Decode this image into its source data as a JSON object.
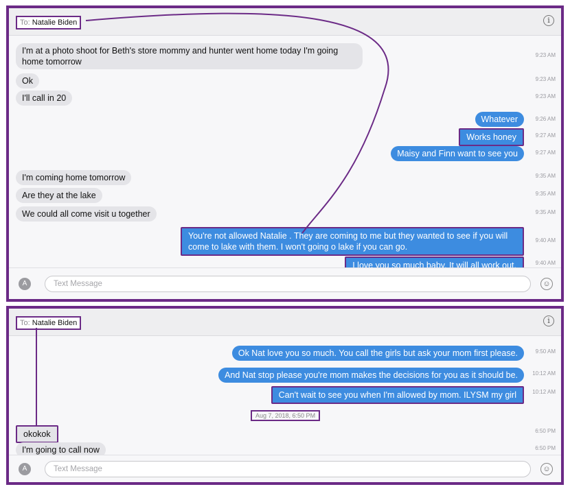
{
  "recipient": {
    "prefix": "To:",
    "name": "Natalie Biden"
  },
  "panel1": {
    "messages": [
      {
        "text": "I'm at a photo shoot for Beth's store mommy and hunter went home today I'm going",
        "text2": "home tomorrow",
        "time": "9:23 AM"
      },
      {
        "text": "Ok",
        "time": "9:23 AM"
      },
      {
        "text": "I'll call in 20",
        "time": "9:23 AM"
      },
      {
        "text": "Whatever",
        "time": "9:26 AM"
      },
      {
        "text": "Works honey",
        "time": "9:27 AM"
      },
      {
        "text": "Maisy and Finn want to see you",
        "time": "9:27 AM"
      },
      {
        "text": "I'm coming home tomorrow",
        "time": "9:35 AM"
      },
      {
        "text": "Are they at the lake",
        "time": "9:35 AM"
      },
      {
        "text": "We could all come visit u together",
        "time": "9:35 AM"
      },
      {
        "text": "You're not allowed Natalie . They are coming to me but they wanted to see if you will",
        "text2": "come to lake with them. I won't going o lake if you can go.",
        "time": "9:40 AM"
      },
      {
        "text": "I love you so much baby. It will all work out.",
        "time": "9:40 AM"
      }
    ]
  },
  "panel2": {
    "messages": [
      {
        "text": "Ok Nat love you so much. You call the girls but ask your mom first please.",
        "time": "9:50 AM"
      },
      {
        "text": "And Nat stop please you're mom makes the decisions for you as it should be.",
        "time": "10:12 AM"
      },
      {
        "text": "Can't wait to see you when I'm allowed by mom. ILYSM my girl",
        "time": "10:12 AM"
      },
      {
        "text": "okokok",
        "time": "6:50 PM"
      },
      {
        "text": "I'm going to call now",
        "time": "6:50 PM"
      }
    ],
    "date_divider": "Aug 7, 2018, 6:50 PM"
  },
  "composer": {
    "placeholder": "Text Message"
  },
  "icons": {
    "info": "info-icon",
    "apps": "app-store-icon",
    "emoji": "emoji-icon"
  },
  "colors": {
    "outgoing": "#3d8ce0",
    "incoming": "#e4e4e8",
    "highlight": "#6b2a86"
  }
}
